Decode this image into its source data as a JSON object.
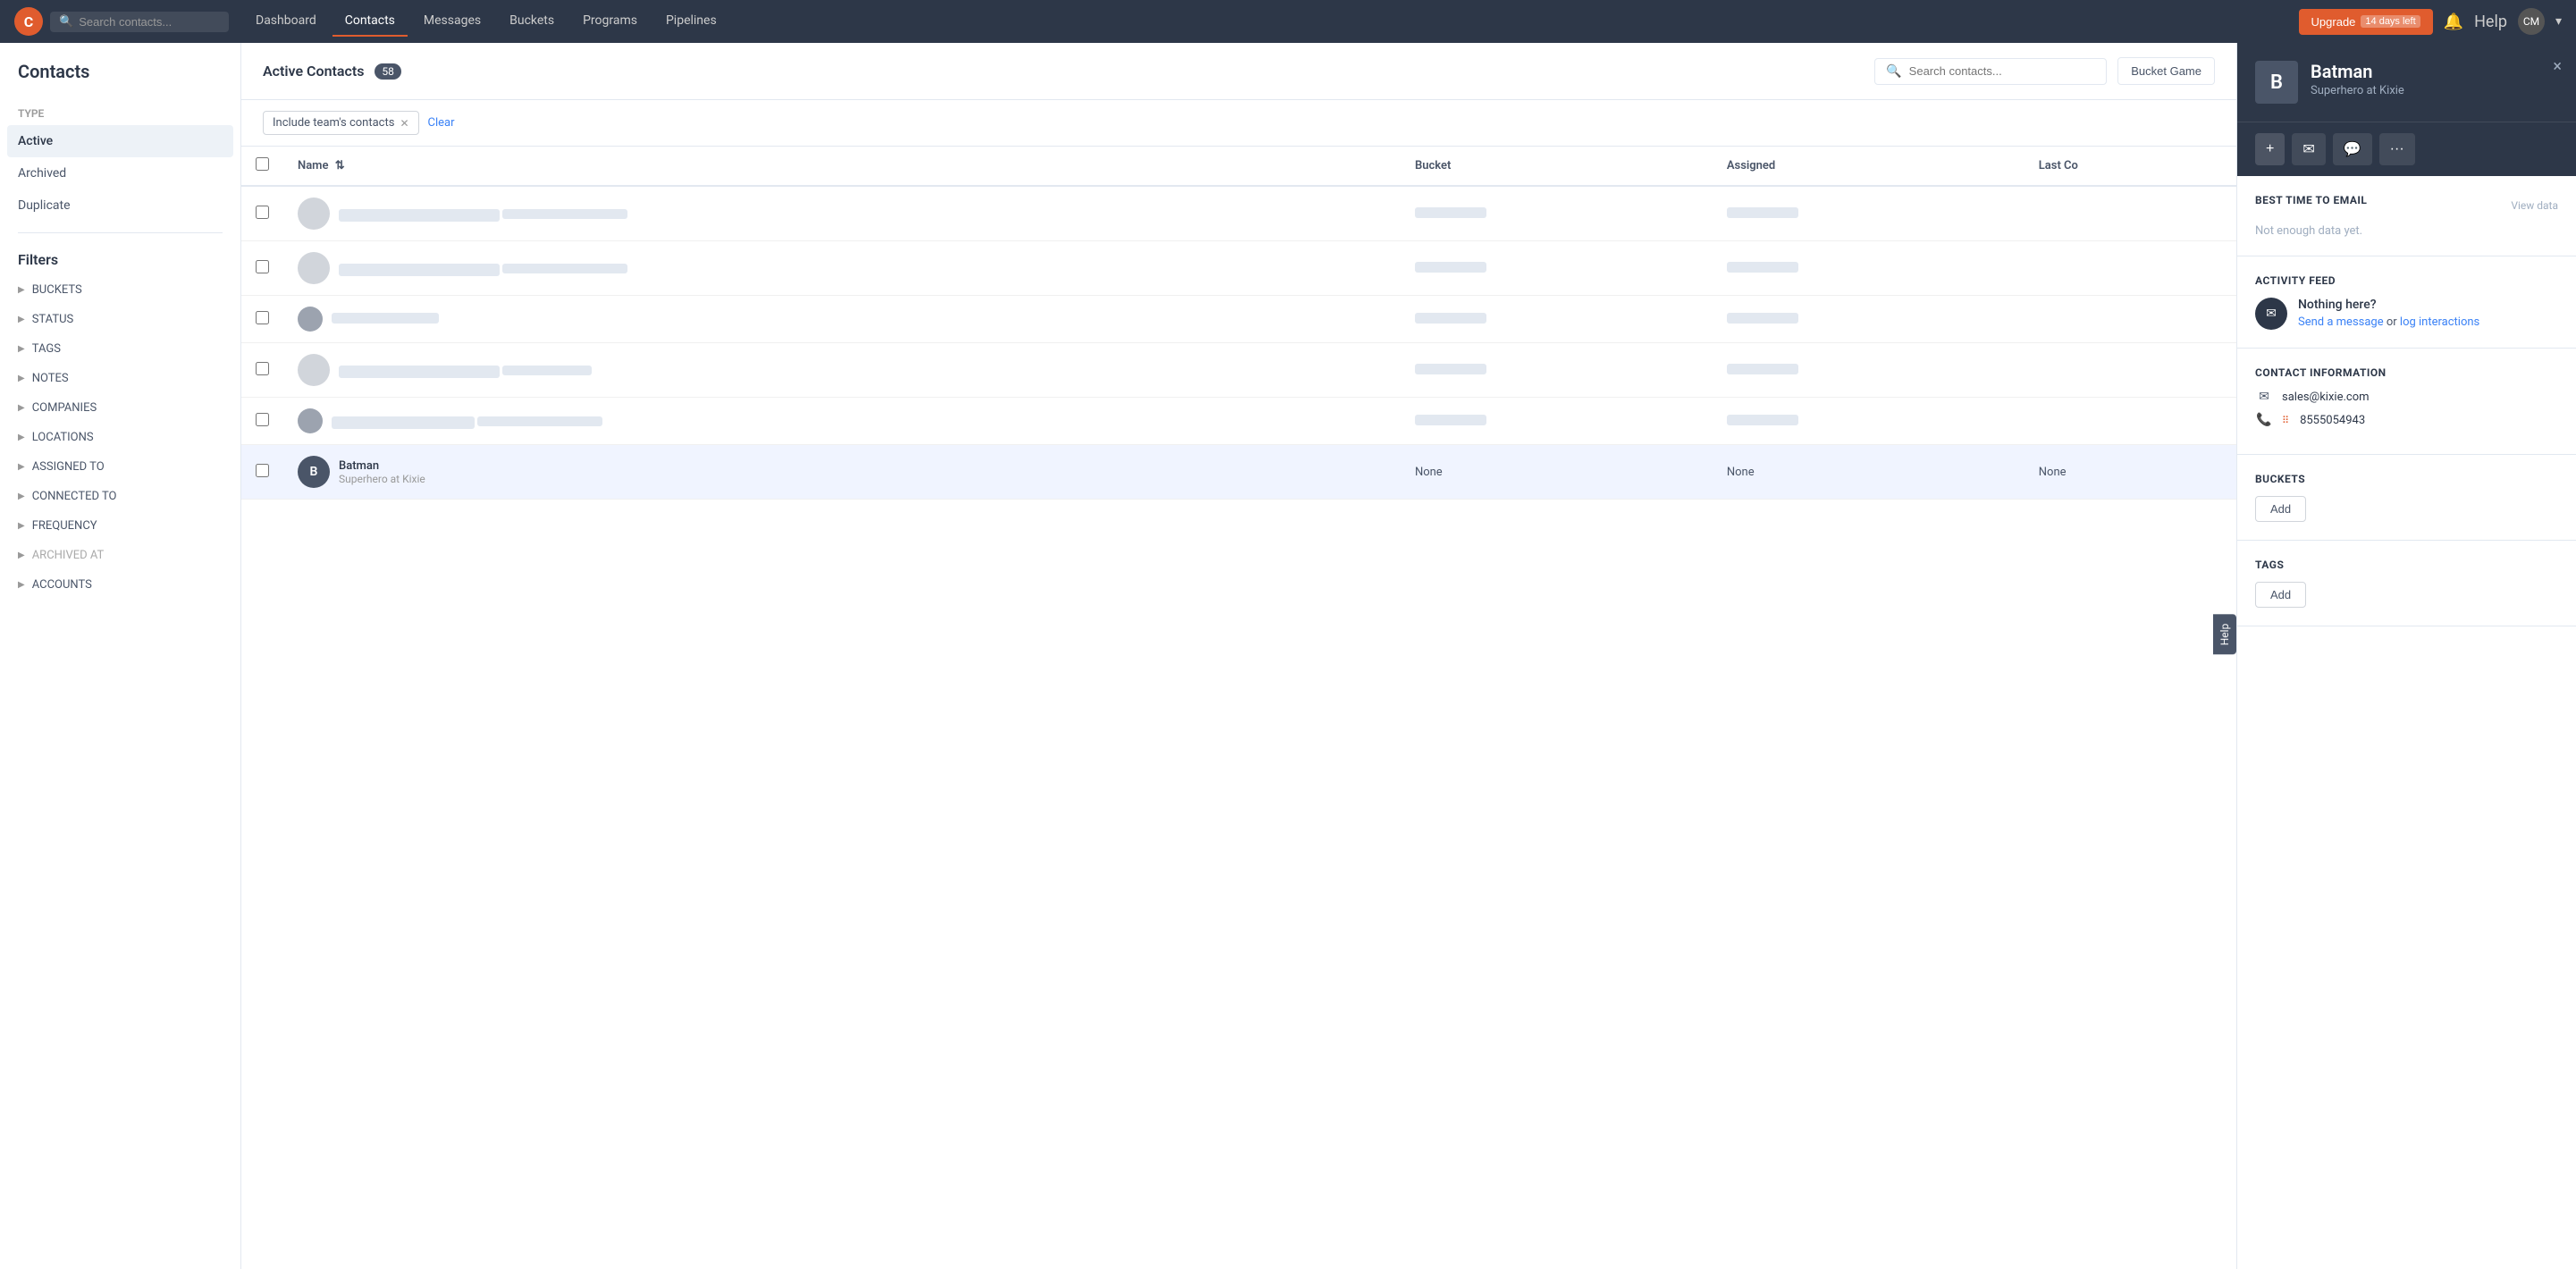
{
  "app": {
    "logo": "C",
    "search_placeholder": "Search contacts...",
    "nav_items": [
      "Dashboard",
      "Contacts",
      "Messages",
      "Buckets",
      "Programs",
      "Pipelines"
    ],
    "active_nav": "Contacts",
    "upgrade_label": "Upgrade",
    "upgrade_badge": "14 days left",
    "help_label": "Help",
    "avatar_initials": "CM"
  },
  "left_sidebar": {
    "title": "Contacts",
    "type_section_label": "Type",
    "type_items": [
      {
        "label": "Active",
        "active": true
      },
      {
        "label": "Archived",
        "active": false
      },
      {
        "label": "Duplicate",
        "active": false
      }
    ],
    "filters_title": "Filters",
    "filter_items": [
      {
        "label": "BUCKETS",
        "disabled": false
      },
      {
        "label": "STATUS",
        "disabled": false
      },
      {
        "label": "TAGS",
        "disabled": false
      },
      {
        "label": "NOTES",
        "disabled": false
      },
      {
        "label": "COMPANIES",
        "disabled": false
      },
      {
        "label": "LOCATIONS",
        "disabled": false
      },
      {
        "label": "ASSIGNED TO",
        "disabled": false
      },
      {
        "label": "CONNECTED TO",
        "disabled": false
      },
      {
        "label": "FREQUENCY",
        "disabled": false
      },
      {
        "label": "ARCHIVED AT",
        "disabled": true
      },
      {
        "label": "ACCOUNTS",
        "disabled": false
      }
    ]
  },
  "main": {
    "page_title": "Active Contacts",
    "count": "58",
    "search_placeholder": "Search contacts...",
    "bucket_btn_label": "Bucket Game",
    "filter_tag": "Include team's contacts",
    "clear_label": "Clear",
    "table": {
      "columns": [
        "Name",
        "Bucket",
        "Assigned",
        "Last Co"
      ],
      "rows": [
        {
          "type": "blurred",
          "bucket": "—",
          "assigned": "—",
          "last": "—"
        },
        {
          "type": "blurred",
          "bucket": "—",
          "assigned": "—",
          "last": "—"
        },
        {
          "type": "blurred",
          "bucket": "—",
          "assigned": "—",
          "last": "—"
        },
        {
          "type": "blurred",
          "bucket": "—",
          "assigned": "—",
          "last": "—"
        },
        {
          "type": "blurred",
          "bucket": "—",
          "assigned": "—",
          "last": "—"
        },
        {
          "type": "batman",
          "name": "Batman",
          "subtitle": "Superhero at Kixie",
          "bucket": "None",
          "assigned": "None",
          "last": "None"
        }
      ]
    }
  },
  "right_panel": {
    "avatar_letter": "B",
    "name": "Batman",
    "subtitle": "Superhero at Kixie",
    "close_icon": "×",
    "plus_btn": "+",
    "email_btn": "✉",
    "chat_btn": "💬",
    "more_btn": "···",
    "best_time_title": "BEST TIME TO EMAIL",
    "view_data_label": "View data",
    "not_enough_data": "Not enough data yet.",
    "activity_feed_title": "ACTIVITY FEED",
    "nothing_here": "Nothing here?",
    "send_message": "Send a message",
    "or_label": "or",
    "log_interactions": "log interactions",
    "contact_info_title": "CONTACT INFORMATION",
    "email": "sales@kixie.com",
    "phone": "8555054943",
    "buckets_title": "BUCKETS",
    "add_bucket_label": "Add",
    "tags_title": "TAGS",
    "add_tag_label": "Add",
    "help_label": "Help"
  }
}
